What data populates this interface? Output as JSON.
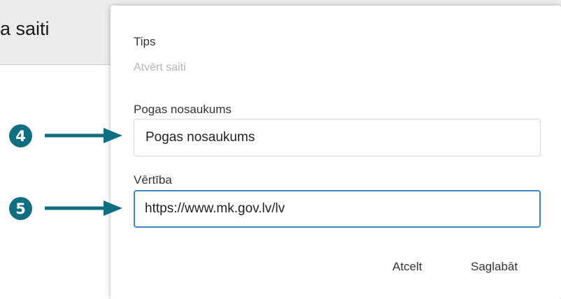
{
  "background": {
    "title": "a saiti"
  },
  "dialog": {
    "type_label": "Tips",
    "type_value": "Atvērt saiti",
    "button_name_label": "Pogas nosaukums",
    "button_name_value": "Pogas nosaukums",
    "value_label": "Vērtība",
    "value_value": "https://www.mk.gov.lv/lv",
    "cancel_label": "Atcelt",
    "save_label": "Saglabāt"
  },
  "annotations": {
    "step_4": "4",
    "step_5": "5",
    "color": "#0f6f80"
  },
  "colors": {
    "focus_border": "#3d86c6",
    "header_bg": "#ececec"
  }
}
